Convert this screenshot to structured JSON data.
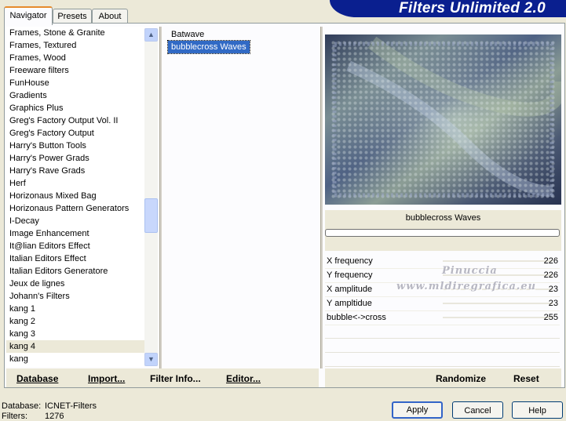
{
  "tabs": [
    "Navigator",
    "Presets",
    "About"
  ],
  "brand": "Filters Unlimited 2.0",
  "categories": [
    "Frames, Stone & Granite",
    "Frames, Textured",
    "Frames, Wood",
    "Freeware filters",
    "FunHouse",
    "Gradients",
    "Graphics Plus",
    "Greg's Factory Output Vol. II",
    "Greg's Factory Output",
    "Harry's Button Tools",
    "Harry's Power Grads",
    "Harry's Rave Grads",
    "Herf",
    "Horizonaus Mixed Bag",
    "Horizonaus Pattern Generators",
    "I-Decay",
    "Image Enhancement",
    "It@lian Editors Effect",
    "Italian Editors Effect",
    "Italian Editors Generatore",
    "Jeux de lignes",
    "Johann's Filters",
    "kang 1",
    "kang 2",
    "kang 3",
    "kang 4",
    "kang"
  ],
  "selected_category": "kang 4",
  "filters": [
    "Batwave",
    "bubblecross Waves"
  ],
  "selected_filter": "bubblecross Waves",
  "current_filter_title": "bubblecross Waves",
  "params": [
    {
      "name": "X frequency",
      "value": "226"
    },
    {
      "name": "Y frequency",
      "value": "226"
    },
    {
      "name": "X amplitude",
      "value": "23"
    },
    {
      "name": "Y ampltidue",
      "value": "23"
    },
    {
      "name": "bubble<->cross",
      "value": "255"
    }
  ],
  "watermark": {
    "line1": "Pinuccia",
    "line2": "www.mldiregrafica.eu"
  },
  "toolbar": {
    "database": "Database",
    "import": "Import...",
    "filter_info": "Filter Info...",
    "editor": "Editor...",
    "randomize": "Randomize",
    "reset": "Reset"
  },
  "status": {
    "database_label": "Database:",
    "database_value": "ICNET-Filters",
    "filters_label": "Filters:",
    "filters_value": "1276"
  },
  "dialog": {
    "apply": "Apply",
    "cancel": "Cancel",
    "help": "Help"
  },
  "icons": {
    "scroll_up": "▲",
    "scroll_down": "▼"
  },
  "colors": {
    "selection": "#316ac5",
    "brand_banner": "#0a1f8f",
    "tab_highlight": "#e68b2c"
  }
}
